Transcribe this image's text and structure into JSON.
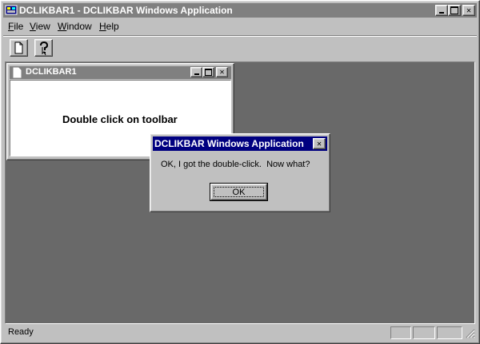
{
  "app": {
    "title": "DCLIKBAR1 - DCLIKBAR Windows Application",
    "colors": {
      "face": "#c0c0c0",
      "workspace": "#696969",
      "active_title": "#000080",
      "inactive_title": "#808080"
    }
  },
  "menu": [
    {
      "label": "File",
      "accel": "F",
      "rest": "ile"
    },
    {
      "label": "View",
      "accel": "V",
      "rest": "iew"
    },
    {
      "label": "Window",
      "accel": "W",
      "rest": "indow"
    },
    {
      "label": "Help",
      "accel": "H",
      "rest": "elp"
    }
  ],
  "toolbar": {
    "buttons": [
      {
        "icon": "new-document-icon"
      },
      {
        "icon": "context-help-icon"
      }
    ]
  },
  "child_window": {
    "title": "DCLIKBAR1",
    "body_text": "Double click on toolbar"
  },
  "dialog": {
    "title": "DCLIKBAR Windows Application",
    "message": "OK, I got the double-click.  Now what?",
    "ok_label": "OK"
  },
  "status": {
    "text": "Ready"
  }
}
